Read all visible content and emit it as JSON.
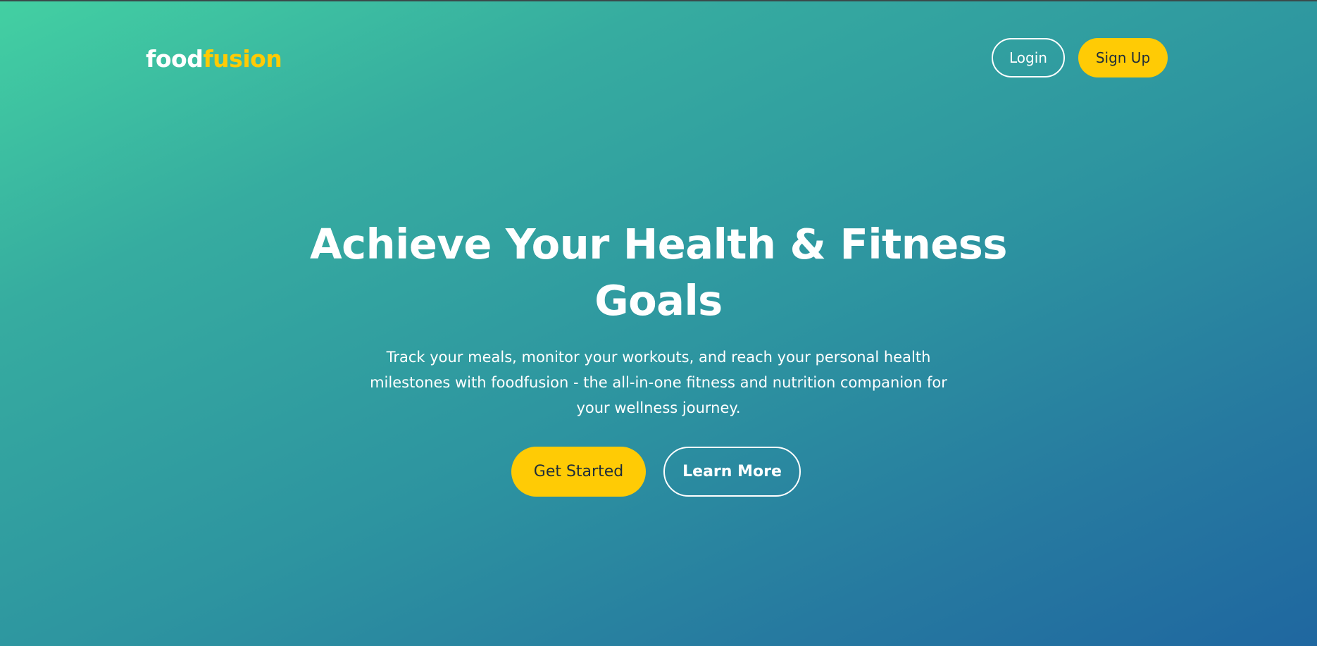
{
  "header": {
    "logo_part1": "food",
    "logo_part2": "fusion",
    "login_label": "Login",
    "signup_label": "Sign Up"
  },
  "hero": {
    "title": "Achieve Your Health & Fitness Goals",
    "description": "Track your meals, monitor your workouts, and reach your personal health milestones with foodfusion - the all-in-one fitness and nutrition companion for your wellness journey.",
    "primary_cta": "Get Started",
    "secondary_cta": "Learn More"
  },
  "colors": {
    "accent": "#ffcb05",
    "gradient_start": "#43d0a2",
    "gradient_end": "#1f67a0",
    "text_light": "#ffffff",
    "text_dark": "#1f2d3a"
  }
}
